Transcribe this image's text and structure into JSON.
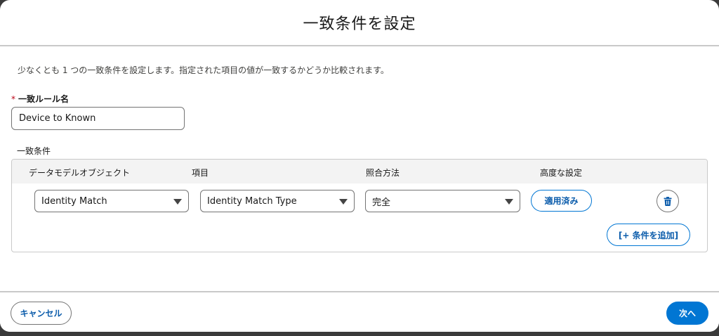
{
  "header": {
    "title": "一致条件を設定"
  },
  "description": "少なくとも 1 つの一致条件を設定します。指定された項目の値が一致するかどうか比較されます。",
  "rule_name": {
    "required_marker": "*",
    "label": "一致ルール名",
    "value": "Device to Known"
  },
  "conditions": {
    "title": "一致条件",
    "columns": {
      "object": "データモデルオブジェクト",
      "field": "項目",
      "method": "照合方法",
      "advanced": "高度な設定"
    },
    "rows": [
      {
        "object": "Identity Match",
        "field": "Identity Match Type",
        "method": "完全",
        "advanced_label": "適用済み"
      }
    ],
    "add_label": "[+ 条件を追加]"
  },
  "footer": {
    "cancel_label": "キャンセル",
    "next_label": "次へ"
  },
  "colors": {
    "brand": "#0176d3",
    "brand_text": "#0b5cab",
    "required": "#ba0517",
    "border": "#c9c9c9",
    "header_bg": "#f3f3f3"
  },
  "icons": {
    "delete": "trash-icon",
    "dropdown": "chevron-down-icon"
  }
}
